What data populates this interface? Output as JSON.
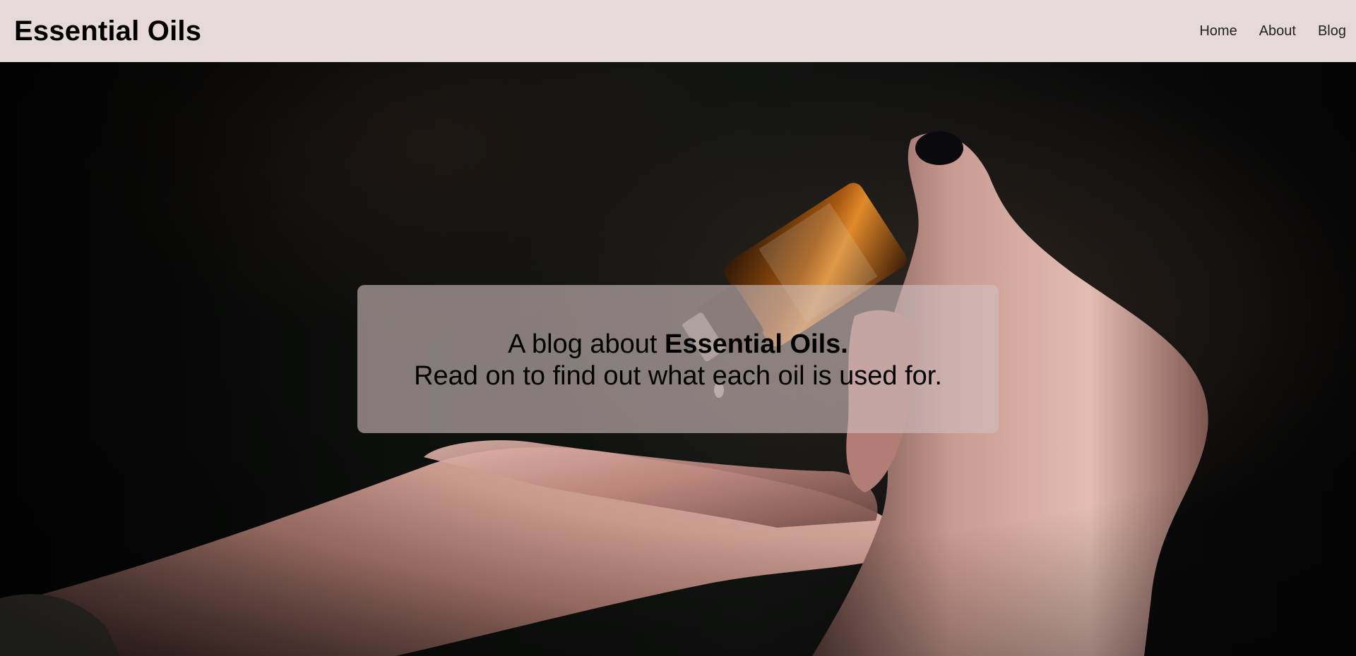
{
  "header": {
    "title": "Essential Oils",
    "nav": [
      {
        "label": "Home"
      },
      {
        "label": "About"
      },
      {
        "label": "Blog"
      }
    ]
  },
  "hero": {
    "line1_prefix": "A blog about ",
    "line1_bold": "Essential Oils.",
    "line2": "Read on to find out what each oil is used for.",
    "image_subject": "hands-pouring-essential-oil-bottle"
  },
  "colors": {
    "header_bg": "#e5d9da",
    "caption_bg": "rgba(206,190,191,0.62)",
    "text": "#000000"
  }
}
